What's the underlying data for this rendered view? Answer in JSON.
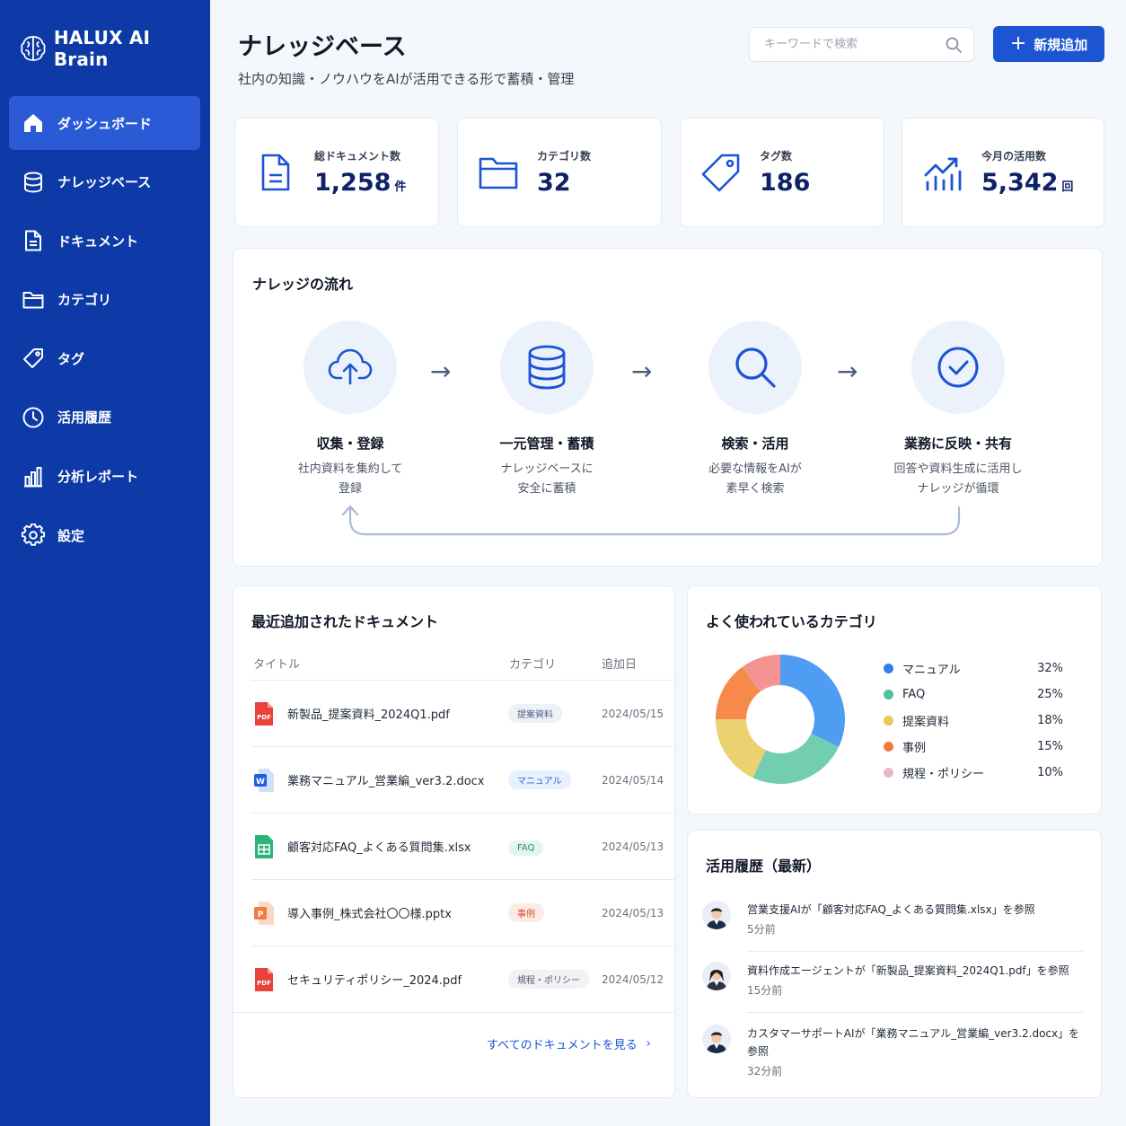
{
  "app": {
    "brand": "HALUX AI Brain"
  },
  "sidebar": {
    "items": [
      {
        "label": "ダッシュボード",
        "icon": "home-icon",
        "active": true
      },
      {
        "label": "ナレッジベース",
        "icon": "database-icon",
        "active": false
      },
      {
        "label": "ドキュメント",
        "icon": "document-icon",
        "active": false
      },
      {
        "label": "カテゴリ",
        "icon": "folder-icon",
        "active": false
      },
      {
        "label": "タグ",
        "icon": "tag-icon",
        "active": false
      },
      {
        "label": "活用履歴",
        "icon": "clock-icon",
        "active": false
      },
      {
        "label": "分析レポート",
        "icon": "bar-chart-icon",
        "active": false
      },
      {
        "label": "設定",
        "icon": "gear-icon",
        "active": false
      }
    ]
  },
  "header": {
    "title": "ナレッジベース",
    "subtitle": "社内の知識・ノウハウをAIが活用できる形で蓄積・管理",
    "search_placeholder": "キーワードで検索",
    "add_label": "新規追加"
  },
  "stats": [
    {
      "label": "総ドキュメント数",
      "value": "1,258",
      "unit": "件",
      "icon": "document-icon"
    },
    {
      "label": "カテゴリ数",
      "value": "32",
      "unit": "",
      "icon": "folder-icon"
    },
    {
      "label": "タグ数",
      "value": "186",
      "unit": "",
      "icon": "tag-icon"
    },
    {
      "label": "今月の活用数",
      "value": "5,342",
      "unit": "回",
      "icon": "trend-chart-icon"
    }
  ],
  "flow": {
    "title": "ナレッジの流れ",
    "steps": [
      {
        "title": "収集・登録",
        "desc1": "社内資料を集約して",
        "desc2": "登録",
        "icon": "cloud-upload-icon"
      },
      {
        "title": "一元管理・蓄積",
        "desc1": "ナレッジベースに",
        "desc2": "安全に蓄積",
        "icon": "database-icon"
      },
      {
        "title": "検索・活用",
        "desc1": "必要な情報をAIが",
        "desc2": "素早く検索",
        "icon": "search-icon"
      },
      {
        "title": "業務に反映・共有",
        "desc1": "回答や資料生成に活用し",
        "desc2": "ナレッジが循環",
        "icon": "check-circle-icon"
      }
    ],
    "arrow": "→"
  },
  "recent": {
    "title": "最近追加されたドキュメント",
    "columns": {
      "title": "タイトル",
      "category": "カテゴリ",
      "date": "追加日"
    },
    "rows": [
      {
        "title": "新製品_提案資料_2024Q1.pdf",
        "category": "提案資料",
        "date": "2024/05/15",
        "file_type": "pdf",
        "file_label": "PDF",
        "tag_bg": "#eef2f8",
        "tag_fg": "#4b5d85"
      },
      {
        "title": "業務マニュアル_営業編_ver3.2.docx",
        "category": "マニュアル",
        "date": "2024/05/14",
        "file_type": "word",
        "file_label": "W",
        "tag_bg": "#e7f0fd",
        "tag_fg": "#2f6ad8"
      },
      {
        "title": "顧客対応FAQ_よくある質問集.xlsx",
        "category": "FAQ",
        "date": "2024/05/13",
        "file_type": "sheet",
        "file_label": "",
        "tag_bg": "#e3f5ee",
        "tag_fg": "#2f8a62"
      },
      {
        "title": "導入事例_株式会社〇〇様.pptx",
        "category": "事例",
        "date": "2024/05/13",
        "file_type": "slides",
        "file_label": "P",
        "tag_bg": "#fdebe7",
        "tag_fg": "#d9492b"
      },
      {
        "title": "セキュリティポリシー_2024.pdf",
        "category": "規程・ポリシー",
        "date": "2024/05/12",
        "file_type": "pdf",
        "file_label": "PDF",
        "tag_bg": "#f1f2f5",
        "tag_fg": "#555e6e"
      }
    ],
    "see_all": "すべてのドキュメントを見る",
    "see_all_chevron": "›"
  },
  "categories": {
    "title": "よく使われているカテゴリ",
    "items": [
      {
        "name": "マニュアル",
        "pct": "32%",
        "value": 32,
        "color": "#4f9cf3"
      },
      {
        "name": "FAQ",
        "pct": "25%",
        "value": 25,
        "color": "#72cdb1"
      },
      {
        "name": "提案資料",
        "pct": "18%",
        "value": 18,
        "color": "#ecd171"
      },
      {
        "name": "事例",
        "pct": "15%",
        "value": 15,
        "color": "#f7894a"
      },
      {
        "name": "規程・ポリシー",
        "pct": "10%",
        "value": 10,
        "color": "#f59393"
      }
    ]
  },
  "activity": {
    "title": "活用履歴（最新）",
    "items": [
      {
        "text": "営業支援AIが「顧客対応FAQ_よくある質問集.xlsx」を参照",
        "time": "5分前",
        "avatar": "male"
      },
      {
        "text": "資料作成エージェントが「新製品_提案資料_2024Q1.pdf」を参照",
        "time": "15分前",
        "avatar": "female"
      },
      {
        "text": "カスタマーサポートAIが「業務マニュアル_営業編_ver3.2.docx」を参照",
        "time": "32分前",
        "avatar": "male"
      }
    ]
  },
  "colors": {
    "sidebar": "#0d3aa7",
    "accent": "#1c54d2",
    "navy": "#0f2167"
  }
}
